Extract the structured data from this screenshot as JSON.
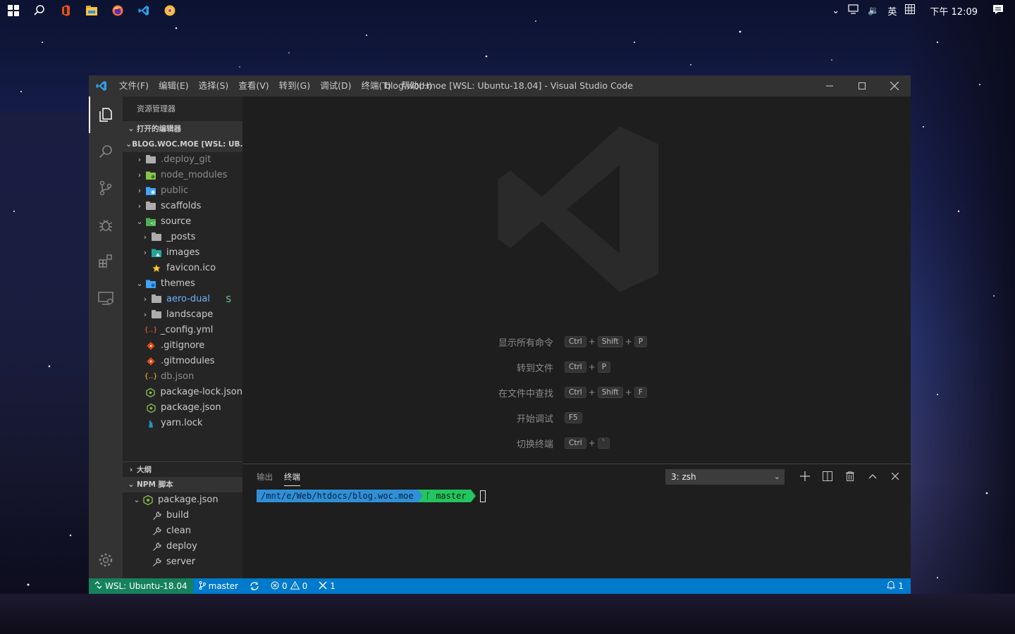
{
  "taskbar": {
    "apps": [
      "windows-start",
      "search",
      "office",
      "file-explorer",
      "firefox",
      "vscode",
      "chrome-canary"
    ],
    "ime": "英",
    "time": "下午 12:09"
  },
  "window": {
    "title": "blog.woc.moe [WSL: Ubuntu-18.04] - Visual Studio Code",
    "menus": [
      "文件(F)",
      "编辑(E)",
      "选择(S)",
      "查看(V)",
      "转到(G)",
      "调试(D)",
      "终端(T)",
      "帮助(H)"
    ]
  },
  "sidebar": {
    "title": "资源管理器",
    "open_editors": "打开的编辑器",
    "workspace": "BLOG.WOC.MOE [WSL: UB...",
    "tree": [
      {
        "label": ".deploy_git",
        "kind": "folder",
        "depth": 1,
        "expanded": false,
        "muted": true
      },
      {
        "label": "node_modules",
        "kind": "folder-node",
        "depth": 1,
        "expanded": false,
        "muted": true
      },
      {
        "label": "public",
        "kind": "folder-public",
        "depth": 1,
        "expanded": false,
        "muted": true
      },
      {
        "label": "scaffolds",
        "kind": "folder",
        "depth": 1,
        "expanded": false
      },
      {
        "label": "source",
        "kind": "folder-src",
        "depth": 1,
        "expanded": true
      },
      {
        "label": "_posts",
        "kind": "folder",
        "depth": 2,
        "expanded": false
      },
      {
        "label": "images",
        "kind": "folder-images",
        "depth": 2,
        "expanded": false
      },
      {
        "label": "favicon.ico",
        "kind": "star",
        "depth": 2
      },
      {
        "label": "themes",
        "kind": "folder-themes",
        "depth": 1,
        "expanded": true
      },
      {
        "label": "aero-dual",
        "kind": "folder",
        "depth": 2,
        "expanded": false,
        "status": "S",
        "blue": true
      },
      {
        "label": "landscape",
        "kind": "folder",
        "depth": 2,
        "expanded": false
      },
      {
        "label": "_config.yml",
        "kind": "yml",
        "depth": 1
      },
      {
        "label": ".gitignore",
        "kind": "git",
        "depth": 1
      },
      {
        "label": ".gitmodules",
        "kind": "git",
        "depth": 1
      },
      {
        "label": "db.json",
        "kind": "json",
        "depth": 1,
        "muted": true
      },
      {
        "label": "package-lock.json",
        "kind": "npm",
        "depth": 1
      },
      {
        "label": "package.json",
        "kind": "npm",
        "depth": 1
      },
      {
        "label": "yarn.lock",
        "kind": "yarn",
        "depth": 1
      }
    ],
    "outline": "大纲",
    "npm_scripts": "NPM 脚本",
    "npm_package": "package.json",
    "npm_items": [
      "build",
      "clean",
      "deploy",
      "server"
    ]
  },
  "welcome": {
    "shortcuts": [
      {
        "label": "显示所有命令",
        "keys": [
          "Ctrl",
          "Shift",
          "P"
        ]
      },
      {
        "label": "转到文件",
        "keys": [
          "Ctrl",
          "P"
        ]
      },
      {
        "label": "在文件中查找",
        "keys": [
          "Ctrl",
          "Shift",
          "F"
        ]
      },
      {
        "label": "开始调试",
        "keys": [
          "F5"
        ]
      },
      {
        "label": "切换终端",
        "keys": [
          "Ctrl",
          "`"
        ]
      }
    ]
  },
  "panel": {
    "tabs": [
      "输出",
      "终端"
    ],
    "active_tab": "终端",
    "terminal_select": "3: zsh",
    "prompt_path": "/mnt/e/Web/htdocs/blog.woc.moe",
    "prompt_branch": "master"
  },
  "statusbar": {
    "remote": "WSL: Ubuntu-18.04",
    "branch": "master",
    "errors": "0",
    "warnings": "0",
    "tools": "1",
    "notifications": "1"
  },
  "colors": {
    "accent": "#007acc",
    "remote": "#16825d",
    "titlebar": "#323233",
    "sidebar": "#252526",
    "editor": "#1e1e1e"
  }
}
